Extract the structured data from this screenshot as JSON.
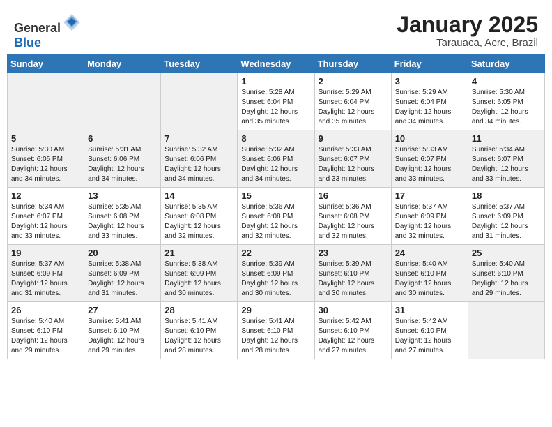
{
  "header": {
    "logo_general": "General",
    "logo_blue": "Blue",
    "month_year": "January 2025",
    "location": "Tarauaca, Acre, Brazil"
  },
  "weekdays": [
    "Sunday",
    "Monday",
    "Tuesday",
    "Wednesday",
    "Thursday",
    "Friday",
    "Saturday"
  ],
  "weeks": [
    [
      {
        "day": "",
        "info": ""
      },
      {
        "day": "",
        "info": ""
      },
      {
        "day": "",
        "info": ""
      },
      {
        "day": "1",
        "info": "Sunrise: 5:28 AM\nSunset: 6:04 PM\nDaylight: 12 hours\nand 35 minutes."
      },
      {
        "day": "2",
        "info": "Sunrise: 5:29 AM\nSunset: 6:04 PM\nDaylight: 12 hours\nand 35 minutes."
      },
      {
        "day": "3",
        "info": "Sunrise: 5:29 AM\nSunset: 6:04 PM\nDaylight: 12 hours\nand 34 minutes."
      },
      {
        "day": "4",
        "info": "Sunrise: 5:30 AM\nSunset: 6:05 PM\nDaylight: 12 hours\nand 34 minutes."
      }
    ],
    [
      {
        "day": "5",
        "info": "Sunrise: 5:30 AM\nSunset: 6:05 PM\nDaylight: 12 hours\nand 34 minutes."
      },
      {
        "day": "6",
        "info": "Sunrise: 5:31 AM\nSunset: 6:06 PM\nDaylight: 12 hours\nand 34 minutes."
      },
      {
        "day": "7",
        "info": "Sunrise: 5:32 AM\nSunset: 6:06 PM\nDaylight: 12 hours\nand 34 minutes."
      },
      {
        "day": "8",
        "info": "Sunrise: 5:32 AM\nSunset: 6:06 PM\nDaylight: 12 hours\nand 34 minutes."
      },
      {
        "day": "9",
        "info": "Sunrise: 5:33 AM\nSunset: 6:07 PM\nDaylight: 12 hours\nand 33 minutes."
      },
      {
        "day": "10",
        "info": "Sunrise: 5:33 AM\nSunset: 6:07 PM\nDaylight: 12 hours\nand 33 minutes."
      },
      {
        "day": "11",
        "info": "Sunrise: 5:34 AM\nSunset: 6:07 PM\nDaylight: 12 hours\nand 33 minutes."
      }
    ],
    [
      {
        "day": "12",
        "info": "Sunrise: 5:34 AM\nSunset: 6:07 PM\nDaylight: 12 hours\nand 33 minutes."
      },
      {
        "day": "13",
        "info": "Sunrise: 5:35 AM\nSunset: 6:08 PM\nDaylight: 12 hours\nand 33 minutes."
      },
      {
        "day": "14",
        "info": "Sunrise: 5:35 AM\nSunset: 6:08 PM\nDaylight: 12 hours\nand 32 minutes."
      },
      {
        "day": "15",
        "info": "Sunrise: 5:36 AM\nSunset: 6:08 PM\nDaylight: 12 hours\nand 32 minutes."
      },
      {
        "day": "16",
        "info": "Sunrise: 5:36 AM\nSunset: 6:08 PM\nDaylight: 12 hours\nand 32 minutes."
      },
      {
        "day": "17",
        "info": "Sunrise: 5:37 AM\nSunset: 6:09 PM\nDaylight: 12 hours\nand 32 minutes."
      },
      {
        "day": "18",
        "info": "Sunrise: 5:37 AM\nSunset: 6:09 PM\nDaylight: 12 hours\nand 31 minutes."
      }
    ],
    [
      {
        "day": "19",
        "info": "Sunrise: 5:37 AM\nSunset: 6:09 PM\nDaylight: 12 hours\nand 31 minutes."
      },
      {
        "day": "20",
        "info": "Sunrise: 5:38 AM\nSunset: 6:09 PM\nDaylight: 12 hours\nand 31 minutes."
      },
      {
        "day": "21",
        "info": "Sunrise: 5:38 AM\nSunset: 6:09 PM\nDaylight: 12 hours\nand 30 minutes."
      },
      {
        "day": "22",
        "info": "Sunrise: 5:39 AM\nSunset: 6:09 PM\nDaylight: 12 hours\nand 30 minutes."
      },
      {
        "day": "23",
        "info": "Sunrise: 5:39 AM\nSunset: 6:10 PM\nDaylight: 12 hours\nand 30 minutes."
      },
      {
        "day": "24",
        "info": "Sunrise: 5:40 AM\nSunset: 6:10 PM\nDaylight: 12 hours\nand 30 minutes."
      },
      {
        "day": "25",
        "info": "Sunrise: 5:40 AM\nSunset: 6:10 PM\nDaylight: 12 hours\nand 29 minutes."
      }
    ],
    [
      {
        "day": "26",
        "info": "Sunrise: 5:40 AM\nSunset: 6:10 PM\nDaylight: 12 hours\nand 29 minutes."
      },
      {
        "day": "27",
        "info": "Sunrise: 5:41 AM\nSunset: 6:10 PM\nDaylight: 12 hours\nand 29 minutes."
      },
      {
        "day": "28",
        "info": "Sunrise: 5:41 AM\nSunset: 6:10 PM\nDaylight: 12 hours\nand 28 minutes."
      },
      {
        "day": "29",
        "info": "Sunrise: 5:41 AM\nSunset: 6:10 PM\nDaylight: 12 hours\nand 28 minutes."
      },
      {
        "day": "30",
        "info": "Sunrise: 5:42 AM\nSunset: 6:10 PM\nDaylight: 12 hours\nand 27 minutes."
      },
      {
        "day": "31",
        "info": "Sunrise: 5:42 AM\nSunset: 6:10 PM\nDaylight: 12 hours\nand 27 minutes."
      },
      {
        "day": "",
        "info": ""
      }
    ]
  ]
}
